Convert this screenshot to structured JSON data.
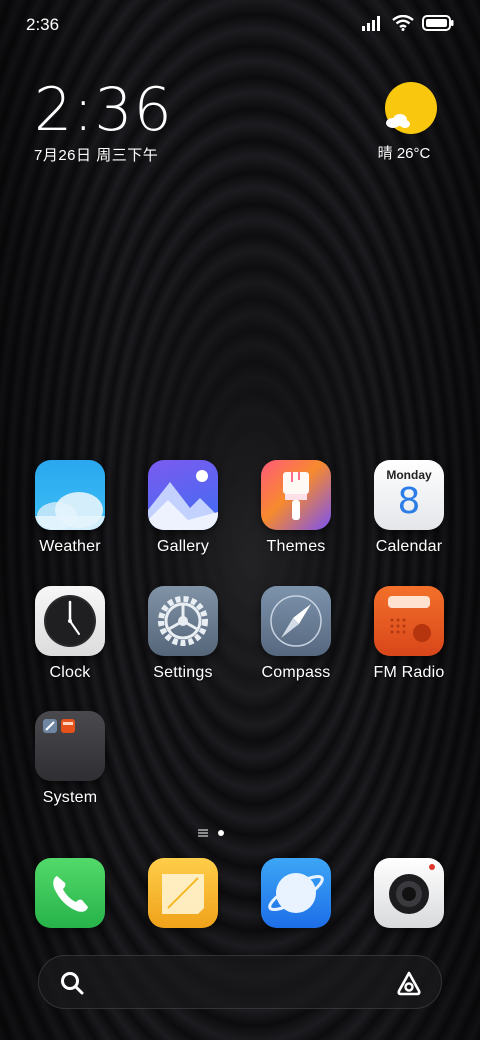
{
  "status_bar": {
    "time": "2:36",
    "icons": [
      "signal-icon",
      "wifi-icon",
      "battery-icon"
    ]
  },
  "clock_widget": {
    "time": "2:36",
    "date": "7月26日 周三下午"
  },
  "weather_widget": {
    "icon": "sunny-partly-cloudy-icon",
    "text": "晴 26°C"
  },
  "apps": [
    {
      "label": "Weather",
      "icon": "weather-icon"
    },
    {
      "label": "Gallery",
      "icon": "gallery-icon"
    },
    {
      "label": "Themes",
      "icon": "themes-icon"
    },
    {
      "label": "Calendar",
      "icon": "calendar-icon"
    },
    {
      "label": "Clock",
      "icon": "clock-icon"
    },
    {
      "label": "Settings",
      "icon": "settings-icon"
    },
    {
      "label": "Compass",
      "icon": "compass-icon"
    },
    {
      "label": "FM Radio",
      "icon": "radio-icon"
    },
    {
      "label": "System",
      "icon": "folder-icon"
    }
  ],
  "calendar_icon": {
    "weekday": "Monday",
    "day": "8"
  },
  "page_indicator": {
    "pages": 2,
    "current": 2
  },
  "dock": [
    {
      "icon": "phone-icon"
    },
    {
      "icon": "notes-icon"
    },
    {
      "icon": "browser-icon"
    },
    {
      "icon": "camera-icon"
    }
  ],
  "search_bar": {
    "left_icon": "search-icon",
    "right_icon": "assistant-icon"
  },
  "colors": {
    "sun": "#f9c80e",
    "calendar_accent": "#2d7de8",
    "radio_orange": "#f4702a"
  }
}
